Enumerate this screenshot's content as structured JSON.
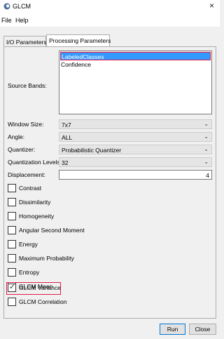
{
  "window": {
    "title": "GLCM",
    "icon": "glcm-app-icon",
    "close_icon": "×"
  },
  "menu": [
    "File",
    "Help"
  ],
  "tabs": [
    {
      "label": "I/O Parameters",
      "active": false
    },
    {
      "label": "Processing Parameters",
      "active": true
    }
  ],
  "source_bands": {
    "label": "Source Bands:",
    "items": [
      {
        "label": "LabeledClasses",
        "selected": true
      },
      {
        "label": "Confidence",
        "selected": false
      }
    ]
  },
  "window_size": {
    "label": "Window Size:",
    "value": "7x7"
  },
  "angle": {
    "label": "Angle:",
    "value": "ALL"
  },
  "quantizer": {
    "label": "Quantizer:",
    "value": "Probabilistic Quantizer"
  },
  "quantization_levels": {
    "label": "Quantization Levels:",
    "value": "32"
  },
  "displacement": {
    "label": "Displacement:",
    "value": "4"
  },
  "features": [
    {
      "label": "Contrast",
      "checked": false
    },
    {
      "label": "Dissimilarity",
      "checked": false
    },
    {
      "label": "Homogeneity",
      "checked": false
    },
    {
      "label": "Angular Second Moment",
      "checked": false
    },
    {
      "label": "Energy",
      "checked": false
    },
    {
      "label": "Maximum Probability",
      "checked": false
    },
    {
      "label": "Entropy",
      "checked": false
    },
    {
      "label": "GLCM Mean",
      "checked": false
    },
    {
      "label": "GLCM Variance",
      "checked": true
    },
    {
      "label": "GLCM Correlation",
      "checked": false
    }
  ],
  "buttons": {
    "run": "Run",
    "close": "Close"
  },
  "colors": {
    "selection": "#3399ff",
    "highlight_border": "#e11d48"
  }
}
